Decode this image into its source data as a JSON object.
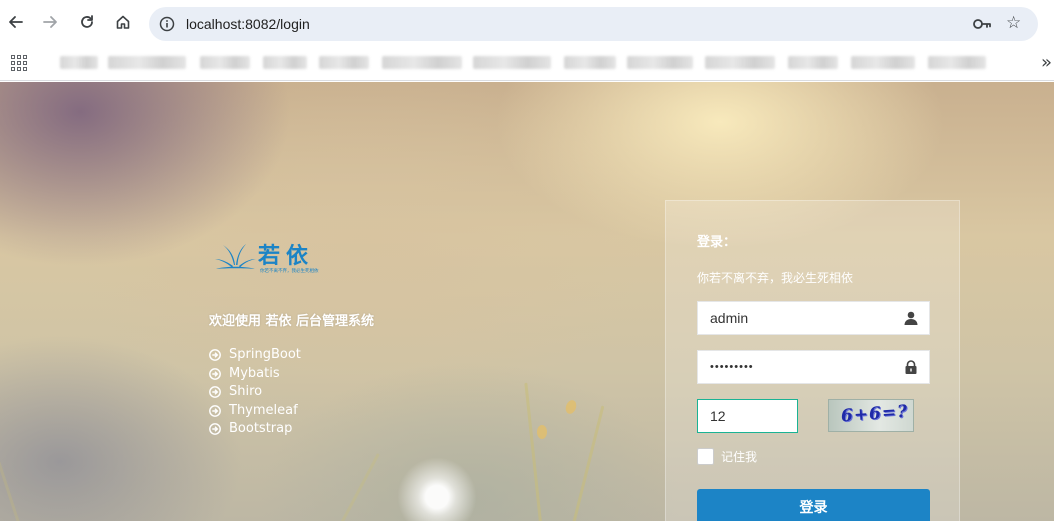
{
  "browser": {
    "url": "localhost:8082/login",
    "icons": {
      "back": "back-arrow-icon",
      "forward": "forward-arrow-icon",
      "reload": "reload-icon",
      "home": "home-icon",
      "site_info": "info-icon",
      "password_key": "key-icon",
      "bookmark_star": "star-icon",
      "apps": "apps-grid-icon",
      "more_bookmarks": "chevron-double-right-icon"
    }
  },
  "brand": {
    "logo_text": "若依",
    "logo_tagline": "你若不离不弃，我必生死相依",
    "welcome": "欢迎使用 若依 后台管理系统",
    "tech_stack": [
      "SpringBoot",
      "Mybatis",
      "Shiro",
      "Thymeleaf",
      "Bootstrap"
    ],
    "accent_color": "#1c84c6"
  },
  "login": {
    "title": "登录：",
    "subtitle": "你若不离不弃，我必生死相依",
    "username": "admin",
    "password_mask": "•••••••••",
    "captcha_value": "12",
    "captcha_code": "6+6=?",
    "remember_label": "记住我",
    "remember_checked": false,
    "submit_label": "登录"
  }
}
